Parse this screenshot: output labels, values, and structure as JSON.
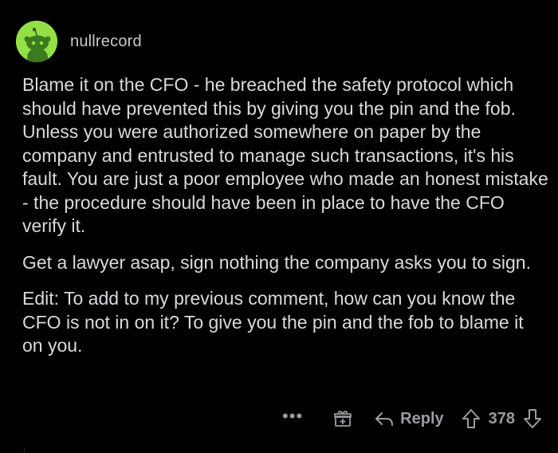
{
  "comment": {
    "username": "nullrecord",
    "paragraphs": [
      "Blame it on the CFO - he breached the safety protocol which should have prevented this by giving you the pin and the fob. Unless you were authorized somewhere on paper by the company and entrusted to manage such transactions, it's his fault. You are just a poor employee who made an honest mistake - the procedure should have been in place to have the CFO verify it.",
      "Get a lawyer asap, sign nothing the company asks you to sign.",
      "Edit: To add to my previous comment, how can you know the CFO is not in on it? To give you the pin and the fob to blame it on you."
    ]
  },
  "actions": {
    "more_label": "•••",
    "reply_label": "Reply",
    "score": "378"
  },
  "icons": {
    "avatar": "snoo-avatar-icon",
    "award": "gift-icon",
    "reply": "reply-arrow-icon",
    "upvote": "upvote-arrow-icon",
    "downvote": "downvote-arrow-icon"
  },
  "colors": {
    "background": "#000000",
    "text": "#d7dadc",
    "muted": "#9a9da0",
    "avatar_bg": "#94e044"
  }
}
